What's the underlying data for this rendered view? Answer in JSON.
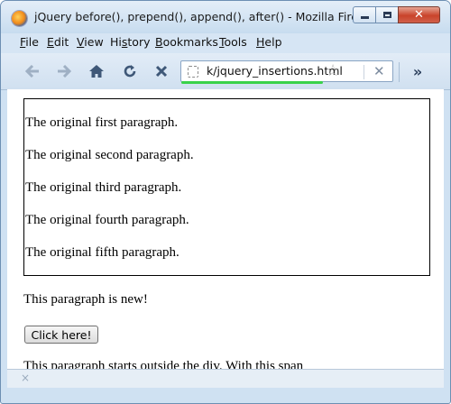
{
  "window": {
    "title": "jQuery before(), prepend(), append(), after() - Mozilla Firefox"
  },
  "menu": {
    "items": [
      {
        "accel": "F",
        "rest": "ile"
      },
      {
        "accel": "E",
        "rest": "dit"
      },
      {
        "accel": "V",
        "rest": "iew"
      },
      {
        "pre": "Hi",
        "accel": "s",
        "rest": "tory"
      },
      {
        "accel": "B",
        "rest": "ookmarks"
      },
      {
        "accel": "T",
        "rest": "ools"
      },
      {
        "accel": "H",
        "rest": "elp"
      }
    ]
  },
  "toolbar": {
    "url": "k/jquery_insertions.html",
    "load_progress": 0.67
  },
  "page": {
    "div_paragraphs": [
      "The original first paragraph.",
      "The original second paragraph.",
      "The original third paragraph.",
      "The original fourth paragraph.",
      "The original fifth paragraph."
    ],
    "new_paragraph": "This paragraph is new!",
    "button_label": "Click here!",
    "outside_paragraph": "This paragraph starts outside the div. With this span"
  },
  "statusbar": {
    "close_glyph": "×"
  }
}
